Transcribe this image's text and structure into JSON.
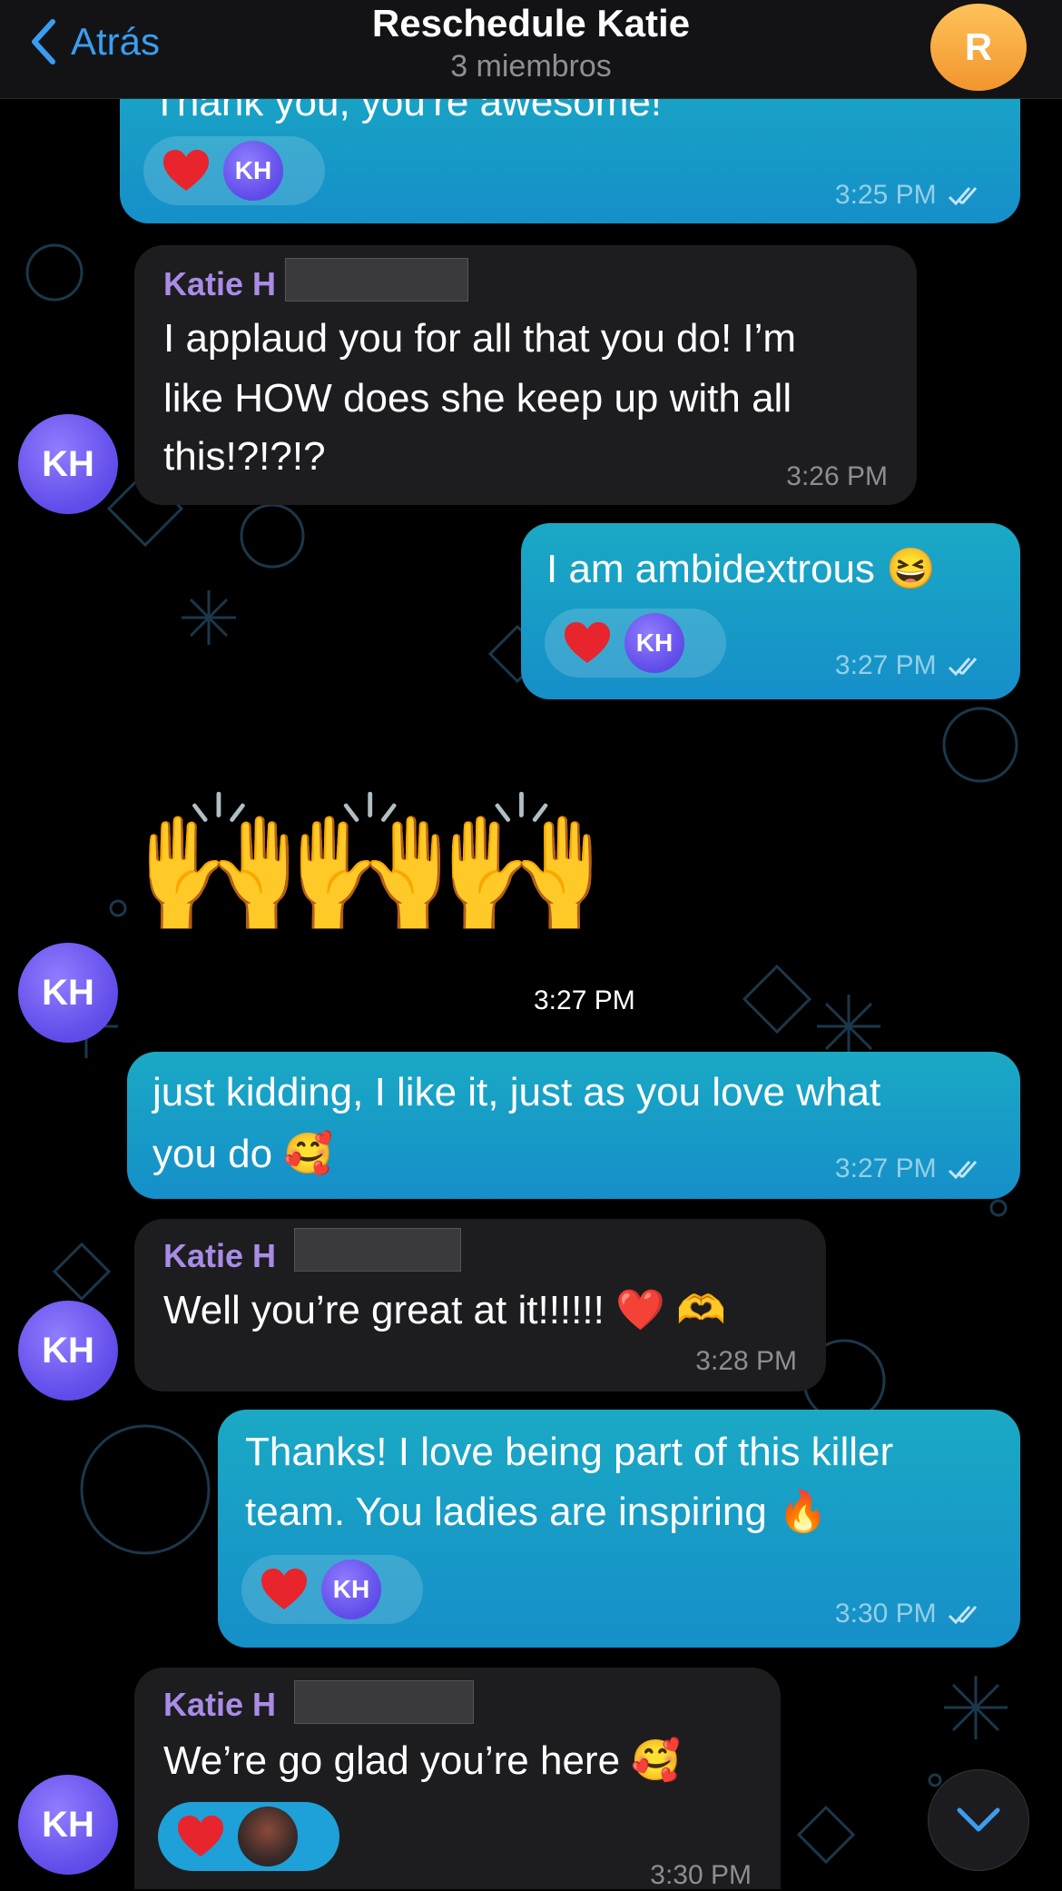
{
  "header": {
    "back_label": "Atrás",
    "title": "Reschedule Katie",
    "subtitle": "3 miembros",
    "avatar_initial": "R",
    "avatar_color": "#f7a23b",
    "accent_color": "#3a9df0"
  },
  "messages": [
    {
      "direction": "outgoing",
      "text_lines": [
        "Thank you, you're awesome!"
      ],
      "time": "3:25 PM",
      "reactions": [
        "heart",
        "KH"
      ],
      "read": true
    },
    {
      "direction": "incoming",
      "sender": "Katie H",
      "avatar": "KH",
      "text_lines": [
        "I applaud you for all that you do! I’m",
        "like HOW does she keep up with all",
        "this!?!?!?"
      ],
      "time": "3:26 PM"
    },
    {
      "direction": "outgoing",
      "text_lines": [
        "I am ambidextrous 😆"
      ],
      "time": "3:27 PM",
      "reactions": [
        "heart",
        "KH"
      ],
      "read": true
    },
    {
      "direction": "incoming",
      "avatar": "KH",
      "emoji": "🙌🙌🙌",
      "time": "3:27 PM"
    },
    {
      "direction": "outgoing",
      "text_lines": [
        "just kidding, I like it, just as you love what",
        "you do 🥰"
      ],
      "time": "3:27 PM",
      "read": true
    },
    {
      "direction": "incoming",
      "sender": "Katie H",
      "avatar": "KH",
      "text_lines": [
        "Well you’re great at it!!!!!! ❤️ 🫶"
      ],
      "time": "3:28 PM"
    },
    {
      "direction": "outgoing",
      "text_lines": [
        "Thanks! I love being part of this killer",
        "team. You ladies are inspiring 🔥"
      ],
      "time": "3:30 PM",
      "reactions": [
        "heart",
        "KH"
      ],
      "read": true
    },
    {
      "direction": "incoming",
      "sender": "Katie H",
      "avatar": "KH",
      "text_lines": [
        "We’re go glad you’re here 🥰"
      ],
      "time": "3:30 PM",
      "reactions": [
        "heart",
        "photo-avatar"
      ]
    }
  ]
}
